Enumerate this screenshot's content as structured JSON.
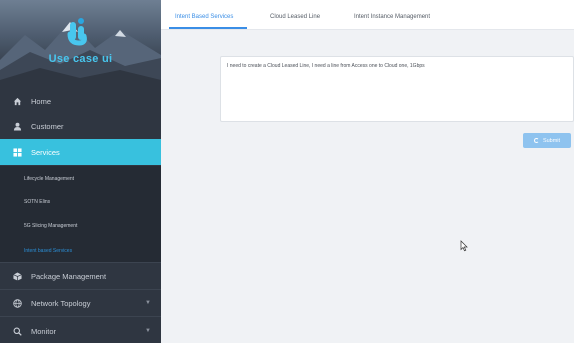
{
  "brand": {
    "name": "Use case ui"
  },
  "menu": [
    {
      "label": "Home",
      "icon": "home-icon"
    },
    {
      "label": "Customer",
      "icon": "user-icon"
    },
    {
      "label": "Services",
      "icon": "grid-icon",
      "active": true
    },
    {
      "label": "Package Management",
      "icon": "package-icon"
    },
    {
      "label": "Network Topology",
      "icon": "globe-icon"
    },
    {
      "label": "Monitor",
      "icon": "search-icon"
    }
  ],
  "submenu": [
    {
      "label": "Lifecycle Management"
    },
    {
      "label": "SOTN Elins"
    },
    {
      "label": "5G Slicing Management"
    },
    {
      "label": "Intent based Services",
      "active": true
    }
  ],
  "tabs": [
    {
      "label": "Intent Based Services",
      "active": true
    },
    {
      "label": "Cloud Leased Line"
    },
    {
      "label": "Intent Instance Management"
    }
  ],
  "intent": {
    "text": "I need to create a Cloud Leased Line, I need a line from Access one to Cloud one, 1Gbps"
  },
  "submit": {
    "label": "Submit"
  },
  "colors": {
    "accent": "#38c1de",
    "tab_active": "#3a8ee6",
    "submit_bg": "#8ec3ef",
    "sidebar_bg": "#2f3641"
  }
}
